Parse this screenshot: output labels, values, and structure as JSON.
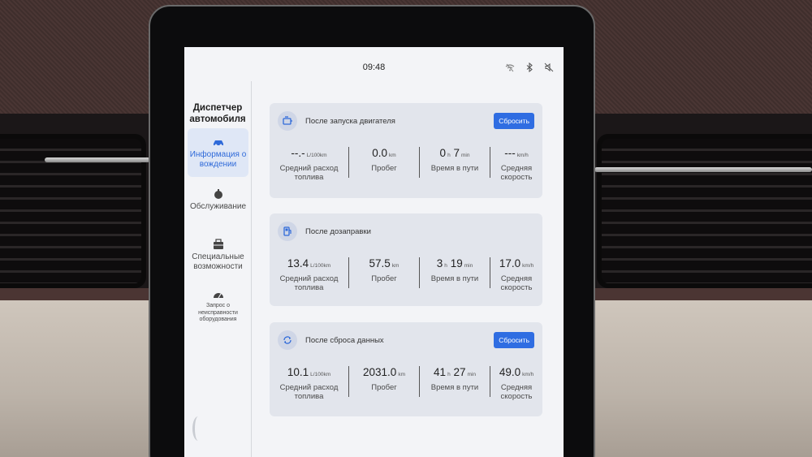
{
  "status": {
    "time": "09:48"
  },
  "sidebar": {
    "title": "Диспетчер автомобиля",
    "items": [
      {
        "label": "Информация о вождении",
        "icon": "car-icon",
        "active": true
      },
      {
        "label": "Обслуживание",
        "icon": "service-icon",
        "active": false
      },
      {
        "label": "Специальные возможности",
        "icon": "toolbox-icon",
        "active": false
      },
      {
        "label": "Запрос о неисправности оборудования",
        "icon": "gauge-icon",
        "active": false
      }
    ]
  },
  "cards": [
    {
      "title": "После запуска двигателя",
      "icon": "engine-icon",
      "reset_label": "Сбросить",
      "stats": [
        {
          "value": "--.-",
          "unit": "L/100km",
          "label": "Средний расход топлива"
        },
        {
          "value": "0.0",
          "unit": "km",
          "label": "Пробег"
        },
        {
          "value_h": "0",
          "unit_h": "h",
          "value_m": "7",
          "unit_m": "min",
          "label": "Время в пути"
        },
        {
          "value": "---",
          "unit": "km/h",
          "label": "Средняя скорость"
        }
      ]
    },
    {
      "title": "После дозаправки",
      "icon": "fuel-icon",
      "stats": [
        {
          "value": "13.4",
          "unit": "L/100km",
          "label": "Средний расход топлива"
        },
        {
          "value": "57.5",
          "unit": "km",
          "label": "Пробег"
        },
        {
          "value_h": "3",
          "unit_h": "h",
          "value_m": "19",
          "unit_m": "min",
          "label": "Время в пути"
        },
        {
          "value": "17.0",
          "unit": "km/h",
          "label": "Средняя скорость"
        }
      ]
    },
    {
      "title": "После сброса данных",
      "icon": "refresh-icon",
      "reset_label": "Сбросить",
      "stats": [
        {
          "value": "10.1",
          "unit": "L/100km",
          "label": "Средний расход топлива"
        },
        {
          "value": "2031.0",
          "unit": "km",
          "label": "Пробег"
        },
        {
          "value_h": "41",
          "unit_h": "h",
          "value_m": "27",
          "unit_m": "min",
          "label": "Время в пути"
        },
        {
          "value": "49.0",
          "unit": "km/h",
          "label": "Средняя скорость"
        }
      ]
    }
  ],
  "colors": {
    "accent": "#2f6de2",
    "active_bg": "#dfe7f6",
    "card_bg": "#e2e5ec"
  }
}
